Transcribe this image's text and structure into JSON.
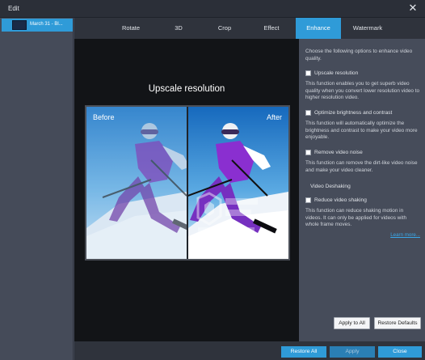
{
  "window": {
    "title": "Edit",
    "close_glyph": "✕"
  },
  "sidebar": {
    "clip_label": "March 31 - Bl..."
  },
  "tabs": [
    {
      "label": "Rotate",
      "active": false
    },
    {
      "label": "3D",
      "active": false
    },
    {
      "label": "Crop",
      "active": false
    },
    {
      "label": "Effect",
      "active": false
    },
    {
      "label": "Enhance",
      "active": true
    },
    {
      "label": "Watermark",
      "active": false
    }
  ],
  "preview": {
    "title": "Upscale resolution",
    "before_label": "Before",
    "after_label": "After"
  },
  "enhance": {
    "intro": "Choose the following options to enhance video quality.",
    "options": [
      {
        "label": "Upscale resolution",
        "checked": false,
        "description": "This function enables you to get superb video quality when you convert lower resolution video to higher resolution video."
      },
      {
        "label": "Optimize brightness and contrast",
        "checked": false,
        "description": "This function will automatically optimize the brightness and contrast to make your video more enjoyable."
      },
      {
        "label": "Remove video noise",
        "checked": false,
        "description": "This function can remove the dirt-like video noise and make your video cleaner."
      },
      {
        "label": "Reduce video shaking",
        "checked": false,
        "description": "This function can reduce shaking motion in videos. It can only be applied for videos with whole frame moves."
      }
    ],
    "deshaking_heading": "Video Deshaking",
    "learn_more": "Learn more...",
    "apply_all": "Apply to All",
    "restore_defaults": "Restore Defaults"
  },
  "footer": {
    "restore_all": "Restore All",
    "apply": "Apply",
    "close": "Close"
  },
  "colors": {
    "accent": "#2f9bd8",
    "title_bar": "#2b2f38",
    "panel": "#464c5a",
    "preview_bg": "#121417"
  }
}
